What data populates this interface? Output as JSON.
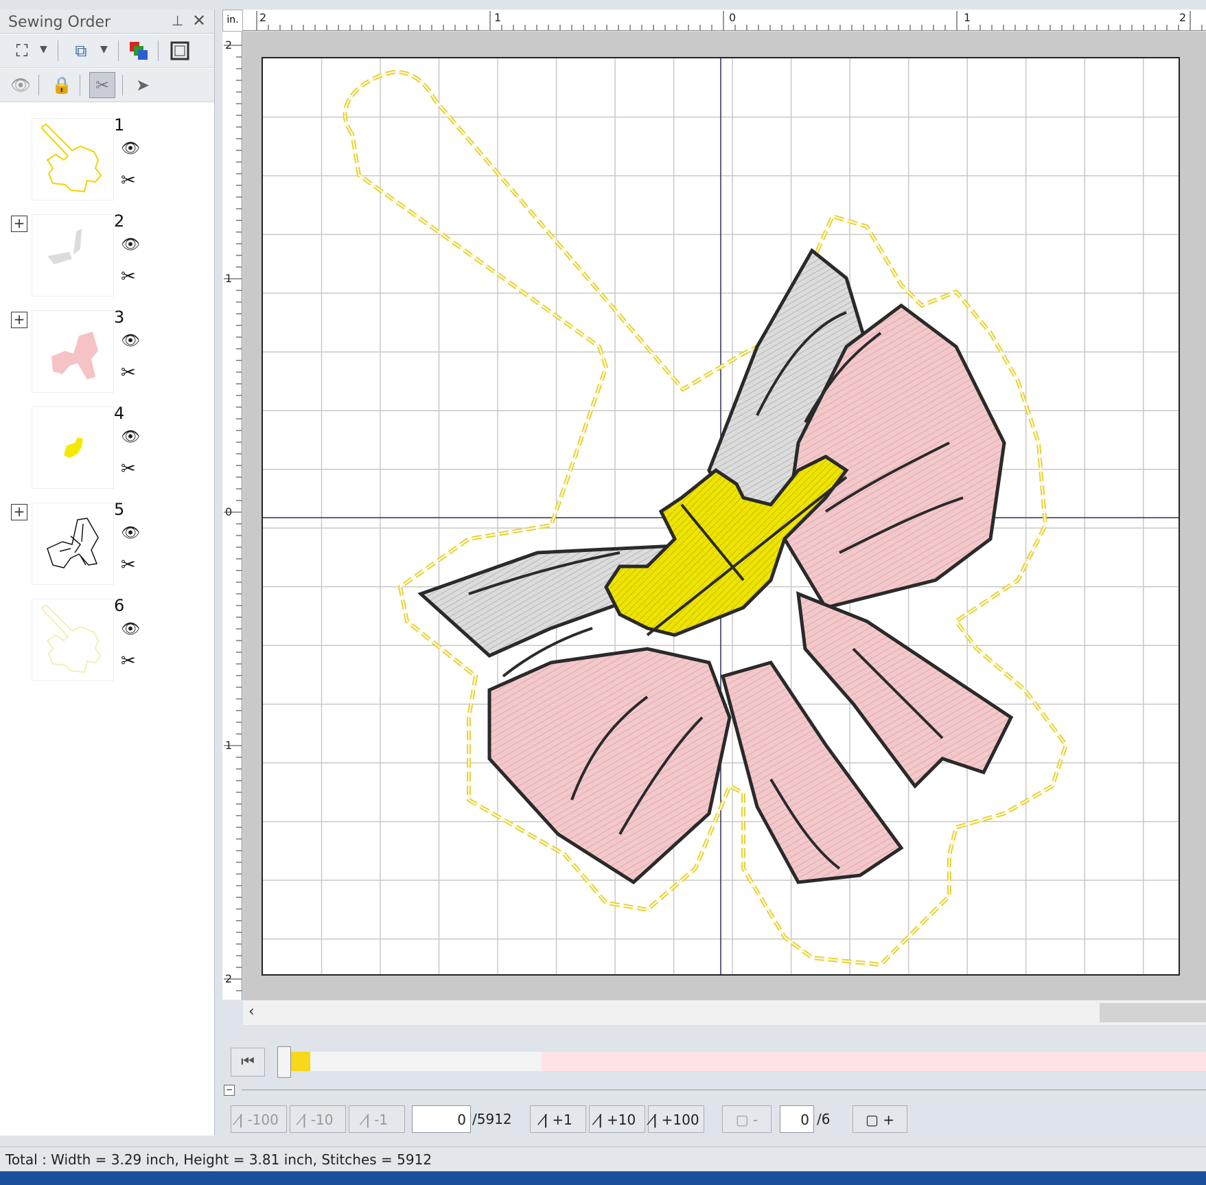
{
  "panel": {
    "title": "Sewing Order",
    "pin_icon": "pin-icon",
    "close_icon": "close-icon",
    "items": [
      {
        "number": "1",
        "thumb_color": "#f3d400",
        "expandable": false
      },
      {
        "number": "2",
        "thumb_color": "#d9d9d9",
        "expandable": true
      },
      {
        "number": "3",
        "thumb_color": "#f4b9be",
        "expandable": true
      },
      {
        "number": "4",
        "thumb_color": "#f3ea00",
        "expandable": false
      },
      {
        "number": "5",
        "thumb_color": "#111111",
        "expandable": true
      },
      {
        "number": "6",
        "thumb_color": "#f7f3bd",
        "expandable": false
      }
    ]
  },
  "ruler": {
    "unit": "in.",
    "h_labels": [
      "2",
      "1",
      "0",
      "1",
      "2"
    ],
    "v_labels": [
      "2",
      "1",
      "0",
      "1",
      "2"
    ]
  },
  "playback": {
    "progress_fraction": 0,
    "color_segments": [
      {
        "color": "#f7d81a",
        "fraction": 0.03
      },
      {
        "color": "#f4f4f4",
        "fraction": 0.25
      },
      {
        "color": "#ffe2e6",
        "fraction": 0.72
      }
    ]
  },
  "stitch_controls": {
    "minus100": "-100",
    "minus10": "-10",
    "minus1": "-1",
    "current_stitch": "0",
    "total_stitches": "/5912",
    "plus1": "+1",
    "plus10": "+10",
    "plus100": "+100",
    "color_minus": "-",
    "current_color": "0",
    "total_colors": "/6",
    "color_plus": "+"
  },
  "status": {
    "text": "Total : Width = 3.29 inch, Height = 3.81 inch, Stitches = 5912"
  },
  "colors": {
    "outline_yellow": "#e8d44a",
    "pink": "#f2c6c9",
    "gray": "#dadada",
    "yellow_fill": "#e9e000",
    "stroke": "#222222",
    "grid": "#c8c8c8"
  }
}
